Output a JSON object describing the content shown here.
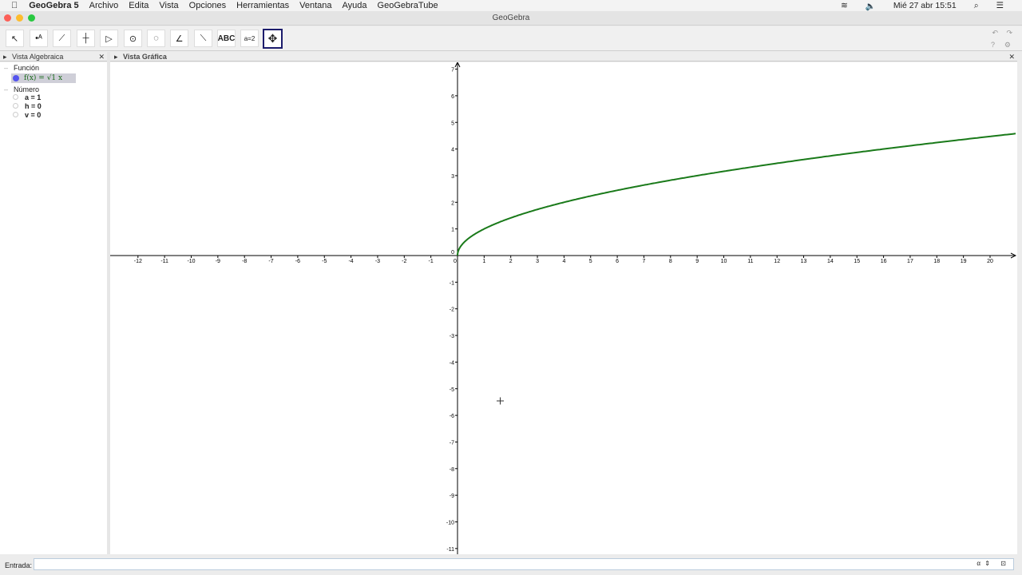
{
  "menubar": {
    "app": "GeoGebra 5",
    "items": [
      "Archivo",
      "Edita",
      "Vista",
      "Opciones",
      "Herramientas",
      "Ventana",
      "Ayuda",
      "GeoGebraTube"
    ],
    "clock": "Mié 27 abr  15:51"
  },
  "window": {
    "title": "GeoGebra"
  },
  "toolbar": {
    "tools": [
      "move",
      "point",
      "line",
      "perpendicular",
      "polygon",
      "circle-center",
      "circle-3pts",
      "angle",
      "reflect",
      "text",
      "slider",
      "move-graphics"
    ],
    "text_label": "ABC",
    "slider_label": "a=2",
    "undo": "↶",
    "redo": "↷",
    "help": "?",
    "settings": "⚙"
  },
  "algebra": {
    "title": "Vista Algebraica",
    "groups": [
      {
        "label": "Función",
        "items": [
          "f(x) = √1 x"
        ]
      },
      {
        "label": "Número",
        "items": [
          "a = 1",
          "h = 0",
          "v = 0"
        ]
      }
    ],
    "func_color": "#5555ee"
  },
  "graphics": {
    "title": "Vista Gráfica",
    "function": "sqrt(a*(x-h))+v",
    "curve_color": "#1a7a1a",
    "xmin": -12,
    "xmax": 20,
    "ymin": -11,
    "ymax": 7
  },
  "input": {
    "label": "Entrada:",
    "value": ""
  }
}
